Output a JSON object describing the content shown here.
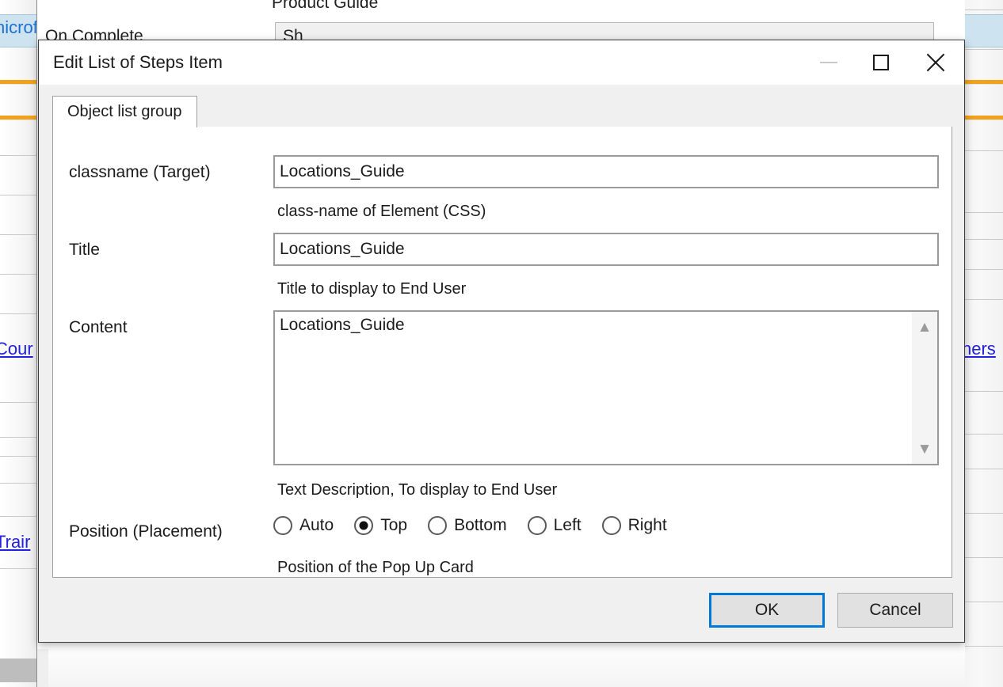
{
  "background": {
    "parent_window": {
      "heading": "Product Guide",
      "field_label": "On Complete",
      "field_value": "Sh"
    },
    "left_strip": {
      "highlight_text": "nicrof",
      "links": [
        "Cour",
        "Trair"
      ]
    },
    "right_strip": {
      "links": [
        "ners"
      ]
    },
    "accent_colors": {
      "orange_rule": "#f0a21c",
      "selected_row": "#cde4f0",
      "hyperlink": "#2222dd"
    }
  },
  "dialog": {
    "title": "Edit List of Steps Item",
    "caption_buttons": {
      "minimize": "minimize-icon",
      "maximize": "maximize-icon",
      "close": "close-icon"
    },
    "tabs": [
      {
        "label": "Object list group",
        "active": true
      }
    ],
    "fields": [
      {
        "label": "classname (Target)",
        "type": "text",
        "value": "Locations_Guide",
        "placeholder": "",
        "help": "class-name of Element (CSS)"
      },
      {
        "label": "Title",
        "type": "text",
        "value": "Locations_Guide",
        "placeholder": "",
        "help": "Title to display to End User"
      },
      {
        "label": "Content",
        "type": "textarea",
        "value": "Locations_Guide",
        "placeholder": "",
        "help": "Text Description, To display to End User"
      }
    ],
    "position_group": {
      "label": "Position (Placement)",
      "help": "Position of the Pop Up Card",
      "options": [
        {
          "label": "Auto",
          "checked": false
        },
        {
          "label": "Top",
          "checked": true
        },
        {
          "label": "Bottom",
          "checked": false
        },
        {
          "label": "Left",
          "checked": false
        },
        {
          "label": "Right",
          "checked": false
        }
      ]
    },
    "footer": {
      "ok_label": "OK",
      "cancel_label": "Cancel",
      "default_button": "OK",
      "focus_color": "#0078d7"
    },
    "scrollbar": {
      "up_arrow": "chevron-up-icon",
      "down_arrow": "chevron-down-icon"
    }
  }
}
